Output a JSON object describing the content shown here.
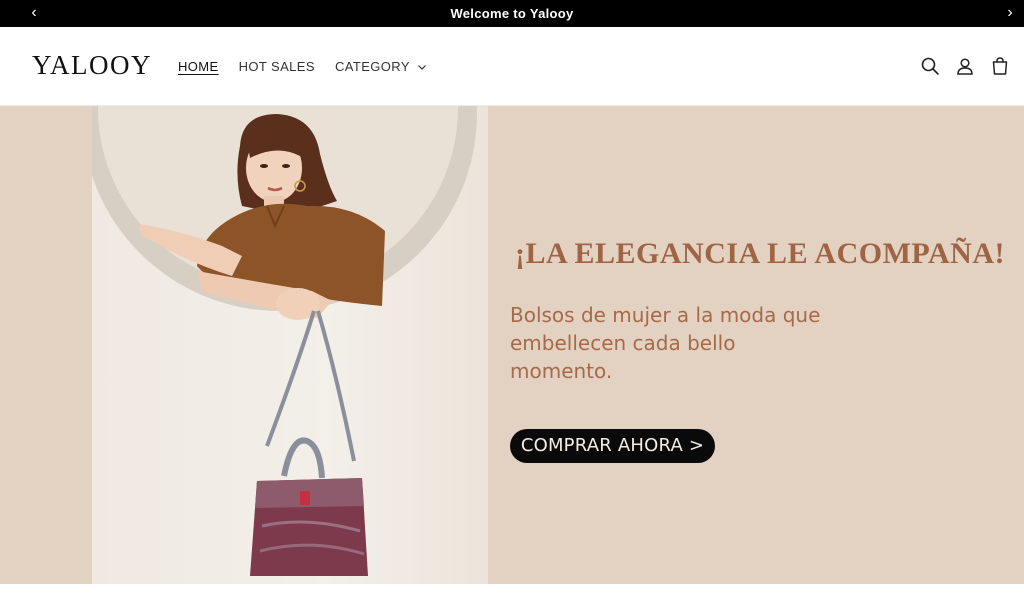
{
  "announcement": {
    "text": "Welcome to Yalooy",
    "prev_arrow": "‹",
    "next_arrow": "›"
  },
  "header": {
    "logo": "YALOOY",
    "nav": [
      {
        "label": "HOME",
        "active": true
      },
      {
        "label": "HOT SALES",
        "active": false
      },
      {
        "label": "CATEGORY",
        "active": false,
        "has_dropdown": true
      }
    ],
    "icons": [
      "search-icon",
      "account-icon",
      "cart-icon"
    ]
  },
  "hero": {
    "headline": "¡LA ELEGANCIA LE ACOMPAÑA!",
    "subline": "Bolsos de mujer a la moda que embellecen cada bello momento.",
    "cta_label": "COMPRAR AHORA  >",
    "colors": {
      "background": "#e3d1c2",
      "headline": "#9e6443",
      "subline": "#a66a4a",
      "cta_bg": "#0a0a0a"
    }
  }
}
